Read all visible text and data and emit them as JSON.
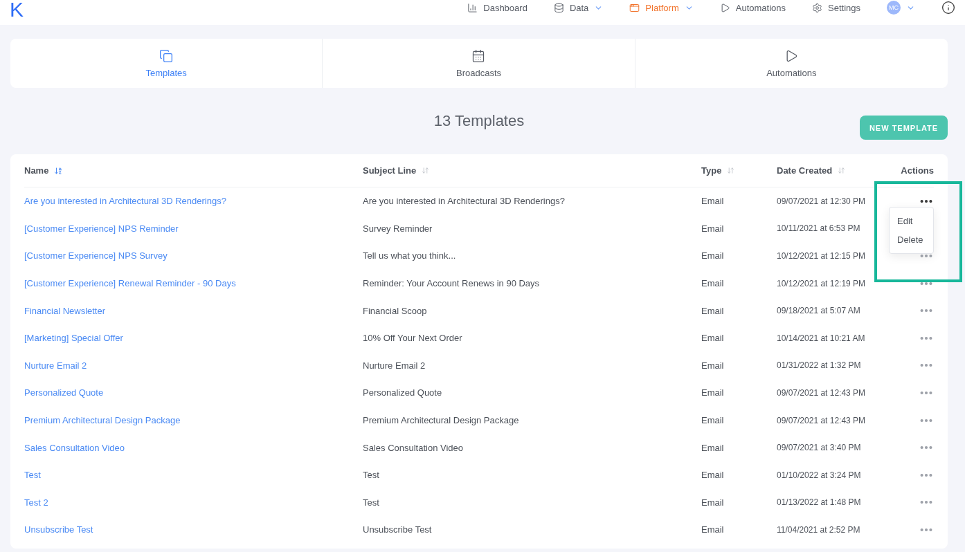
{
  "logo": "K",
  "nav": [
    {
      "label": "Dashboard",
      "selected": false,
      "dropdown": false
    },
    {
      "label": "Data",
      "selected": false,
      "dropdown": true
    },
    {
      "label": "Platform",
      "selected": true,
      "dropdown": true
    },
    {
      "label": "Automations",
      "selected": false,
      "dropdown": false
    },
    {
      "label": "Settings",
      "selected": false,
      "dropdown": false
    }
  ],
  "user": {
    "initials": "MC"
  },
  "tabs": [
    {
      "label": "Templates",
      "selected": true
    },
    {
      "label": "Broadcasts",
      "selected": false
    },
    {
      "label": "Automations",
      "selected": false
    }
  ],
  "heading": "13 Templates",
  "new_button": "NEW TEMPLATE",
  "table": {
    "columns": [
      {
        "label": "Name",
        "sorted": true
      },
      {
        "label": "Subject Line",
        "sorted": false
      },
      {
        "label": "Type",
        "sorted": false
      },
      {
        "label": "Date Created",
        "sorted": false
      },
      {
        "label": "Actions"
      }
    ],
    "rows": [
      {
        "name": "Are you interested in Architectural 3D Renderings?",
        "subject": "Are you interested in Architectural 3D Renderings?",
        "type": "Email",
        "date": "09/07/2021 at 12:30 PM",
        "menu_open": true
      },
      {
        "name": "[Customer Experience] NPS Reminder",
        "subject": "Survey Reminder",
        "type": "Email",
        "date": "10/11/2021 at 6:53 PM",
        "menu_open": false
      },
      {
        "name": "[Customer Experience] NPS Survey",
        "subject": "Tell us what you think...",
        "type": "Email",
        "date": "10/12/2021 at 12:15 PM",
        "menu_open": false
      },
      {
        "name": "[Customer Experience] Renewal Reminder - 90 Days",
        "subject": "Reminder: Your Account Renews in 90 Days",
        "type": "Email",
        "date": "10/12/2021 at 12:19 PM",
        "menu_open": false
      },
      {
        "name": "Financial Newsletter",
        "subject": "Financial Scoop",
        "type": "Email",
        "date": "09/18/2021 at 5:07 AM",
        "menu_open": false
      },
      {
        "name": "[Marketing] Special Offer",
        "subject": "10% Off Your Next Order",
        "type": "Email",
        "date": "10/14/2021 at 10:21 AM",
        "menu_open": false
      },
      {
        "name": "Nurture Email 2",
        "subject": "Nurture Email 2",
        "type": "Email",
        "date": "01/31/2022 at 1:32 PM",
        "menu_open": false
      },
      {
        "name": "Personalized Quote",
        "subject": "Personalized Quote",
        "type": "Email",
        "date": "09/07/2021 at 12:43 PM",
        "menu_open": false
      },
      {
        "name": "Premium Architectural Design Package",
        "subject": "Premium Architectural Design Package",
        "type": "Email",
        "date": "09/07/2021 at 12:43 PM",
        "menu_open": false
      },
      {
        "name": "Sales Consultation Video",
        "subject": "Sales Consultation Video",
        "type": "Email",
        "date": "09/07/2021 at 3:40 PM",
        "menu_open": false
      },
      {
        "name": "Test",
        "subject": "Test",
        "type": "Email",
        "date": "01/10/2022 at 3:24 PM",
        "menu_open": false
      },
      {
        "name": "Test 2",
        "subject": "Test",
        "type": "Email",
        "date": "01/13/2022 at 1:48 PM",
        "menu_open": false
      },
      {
        "name": "Unsubscribe Test",
        "subject": "Unsubscribe Test",
        "type": "Email",
        "date": "11/04/2021 at 2:52 PM",
        "menu_open": false
      }
    ]
  },
  "action_menu": [
    "Edit",
    "Delete"
  ],
  "highlight": {
    "on": true
  }
}
